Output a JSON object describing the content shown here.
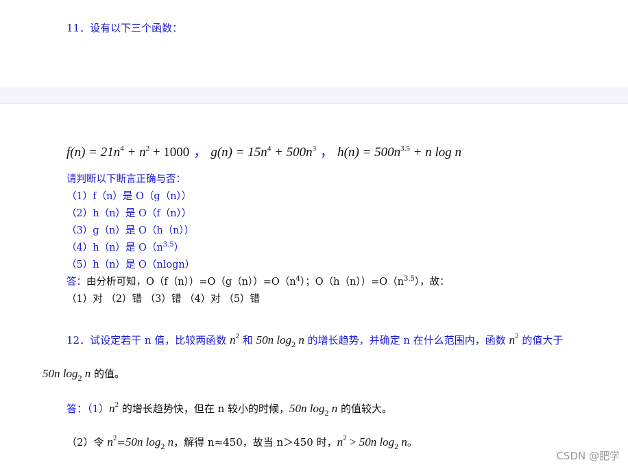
{
  "q11": {
    "title": "11．设有以下三个函数：",
    "formula": {
      "f_lhs": "f(n) = 21n",
      "f_exp1": "4",
      "f_mid": " + n",
      "f_exp2": "2",
      "f_tail": " + 1000",
      "sep1": "，",
      "g_lhs": "g(n) = 15n",
      "g_exp1": "4",
      "g_mid": " + 500n",
      "g_exp2": "3",
      "sep2": "，",
      "h_lhs": "h(n) = 500n",
      "h_exp1": "3.5",
      "h_tail": " + n log n"
    },
    "prompt": "请判断以下断言正确与否：",
    "items": [
      {
        "text": "（1）f（n）是 O（g（n））"
      },
      {
        "text": "（2）h（n）是 O（f（n））"
      },
      {
        "text": "（3）g（n）是 O（h（n））"
      },
      {
        "pre": "（4）h（n）是 O（n",
        "sup": "3.5",
        "post": "）"
      },
      {
        "text": "（5）h（n）是 O（nlogn）"
      }
    ],
    "answer": {
      "label": "答：",
      "t1": "由分析可知，O（f（n））=O（g（n））=O（n",
      "s1": "4",
      "t2": "）；O（h（n））=O（n",
      "s2": "3.5",
      "t3": "），故："
    },
    "results": "（1）对 （2）错 （3）错 （4）对 （5）错"
  },
  "q12": {
    "line1_a": "12．试设定若干 n 值，比较两函数 ",
    "n2": "n",
    "exp2": "2",
    "and": " 和 ",
    "nlog": "50n log",
    "sub2": "2",
    "n": " n",
    "line1_b": " 的增长趋势，并确定 n 在什么范围内，函数 ",
    "line1_c": " 的值大于",
    "line2_tail": " 的值。",
    "ans1_label": "答：（1）",
    "ans1_a": " 的增长趋势快，但在 n 较小的时候，",
    "ans1_b": " 的值较大。",
    "ans2_a": "（2）令 ",
    "ans2_eq": "=",
    "ans2_b": "，解得 n≈450，故当 n＞450 时，",
    "ans2_gt": " > ",
    "ans2_end": "。"
  },
  "watermark": "CSDN @肥学"
}
